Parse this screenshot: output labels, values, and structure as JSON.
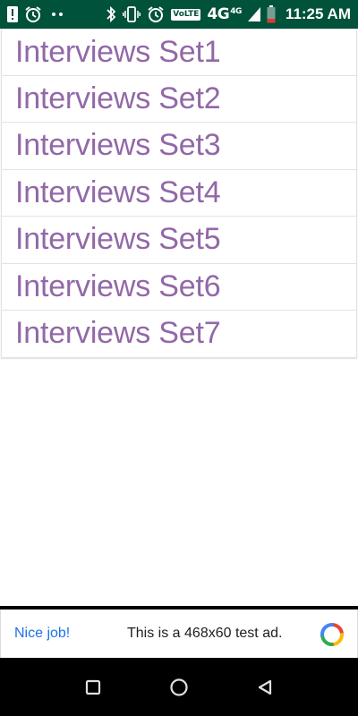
{
  "status_bar": {
    "time": "11:25 AM",
    "volte": "VoLTE",
    "network": "4G",
    "network_small": "4G",
    "left_icons": [
      "alert-icon",
      "alarm-icon",
      "more-dots-icon"
    ],
    "right_icons": [
      "bluetooth-icon",
      "vibrate-icon",
      "alarm-icon",
      "signal-icon",
      "battery-icon"
    ]
  },
  "list": {
    "items": [
      {
        "label": "Interviews Set1"
      },
      {
        "label": "Interviews Set2"
      },
      {
        "label": "Interviews Set3"
      },
      {
        "label": "Interviews Set4"
      },
      {
        "label": "Interviews Set5"
      },
      {
        "label": "Interviews Set6"
      },
      {
        "label": "Interviews Set7"
      }
    ]
  },
  "ad": {
    "cta": "Nice job!",
    "text": "This is a 468x60 test ad."
  },
  "nav_bar": {
    "buttons": [
      "recents-button",
      "home-button",
      "back-button"
    ]
  },
  "colors": {
    "status_bar": "#00523a",
    "list_text": "#9268a8",
    "ad_cta": "#1a73e8"
  }
}
